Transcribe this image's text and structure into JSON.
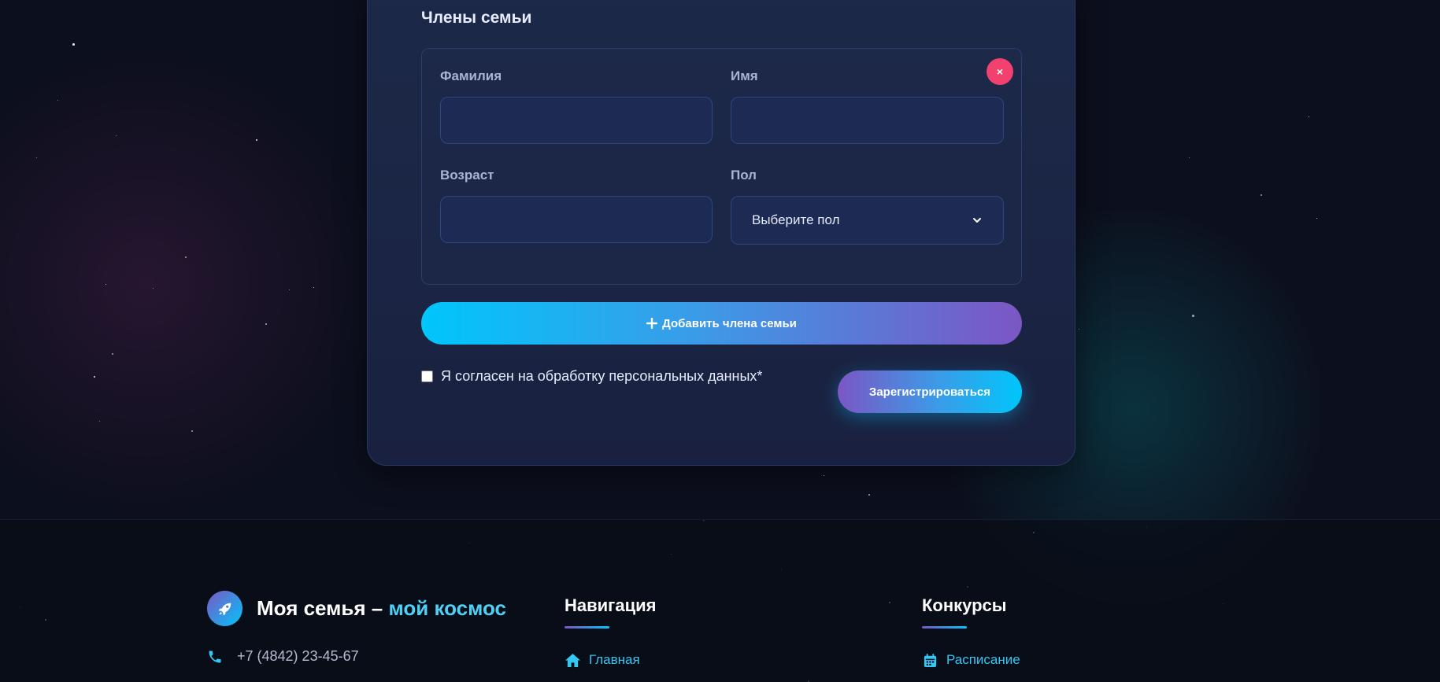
{
  "colors": {
    "background": "#0c0f1d",
    "card": "#1c2948",
    "input": "#1d2b54",
    "accent_cyan": "#00c6fb",
    "accent_purple": "#7c56c4",
    "remove_pink": "#f2406f",
    "link": "#35c6f4"
  },
  "registration": {
    "section_title": "Члены семьи",
    "member": {
      "remove_label": "×",
      "last_name": {
        "label": "Фамилия",
        "value": "",
        "placeholder": ""
      },
      "first_name": {
        "label": "Имя",
        "value": "",
        "placeholder": ""
      },
      "age": {
        "label": "Возраст",
        "value": "",
        "placeholder": ""
      },
      "gender": {
        "label": "Пол",
        "selected": "Выберите пол",
        "icon": "chevron-down-icon"
      }
    },
    "add_member_button": "Добавить члена семьи",
    "consent_label": "Я согласен на обработку персональных данных*",
    "consent_checked": false,
    "submit_button": "Зарегистрироваться"
  },
  "footer": {
    "brand_main": "Моя семья – ",
    "brand_accent": "мой космос",
    "brand_icon": "rocket-icon",
    "phone": "+7 (4842) 23-45-67",
    "phone_icon": "phone-icon",
    "navigation": {
      "heading": "Навигация",
      "links": [
        {
          "label": "Главная",
          "icon": "home-icon"
        }
      ]
    },
    "contests": {
      "heading": "Конкурсы",
      "links": [
        {
          "label": "Расписание",
          "icon": "calendar-icon"
        }
      ]
    }
  }
}
